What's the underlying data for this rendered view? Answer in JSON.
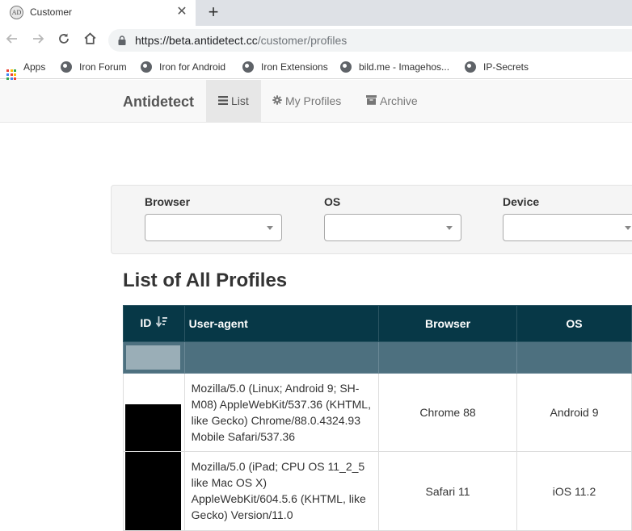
{
  "browser": {
    "tab": {
      "favicon_text": "AD",
      "title": "Customer"
    },
    "url": {
      "host": "https://beta.antidetect.cc",
      "path": "/customer/profiles"
    },
    "bookmarks": [
      {
        "label": "Apps",
        "icon": "apps-grid-icon"
      },
      {
        "label": "Iron Forum",
        "icon": "globe-icon"
      },
      {
        "label": "Iron for Android",
        "icon": "globe-icon"
      },
      {
        "label": "Iron Extensions",
        "icon": "globe-icon"
      },
      {
        "label": "bild.me - Imagehos...",
        "icon": "globe-icon"
      },
      {
        "label": "IP-Secrets",
        "icon": "globe-icon"
      }
    ]
  },
  "navbar": {
    "brand": "Antidetect",
    "links": [
      {
        "label": "List",
        "icon": "list-icon",
        "active": true
      },
      {
        "label": "My Profiles",
        "icon": "gear-icon",
        "active": false
      },
      {
        "label": "Archive",
        "icon": "archive-icon",
        "active": false
      }
    ]
  },
  "filters": {
    "browser_label": "Browser",
    "os_label": "OS",
    "device_label": "Device"
  },
  "page_title": "List of All Profiles",
  "table": {
    "headers": {
      "id": "ID",
      "user_agent": "User-agent",
      "browser": "Browser",
      "os": "OS"
    },
    "rows": [
      {
        "user_agent": "Mozilla/5.0 (Linux; Android 9; SH-M08) AppleWebKit/537.36 (KHTML, like Gecko) Chrome/88.0.4324.93 Mobile Safari/537.36",
        "browser": "Chrome 88",
        "os": "Android 9"
      },
      {
        "user_agent": "Mozilla/5.0 (iPad; CPU OS 11_2_5 like Mac OS X) AppleWebKit/604.5.6 (KHTML, like Gecko) Version/11.0",
        "browser": "Safari 11",
        "os": "iOS 11.2"
      }
    ]
  },
  "colors": {
    "table_header": "#073847",
    "filter_row": "#4d707f",
    "navbar_bg": "#f8f8f8"
  }
}
